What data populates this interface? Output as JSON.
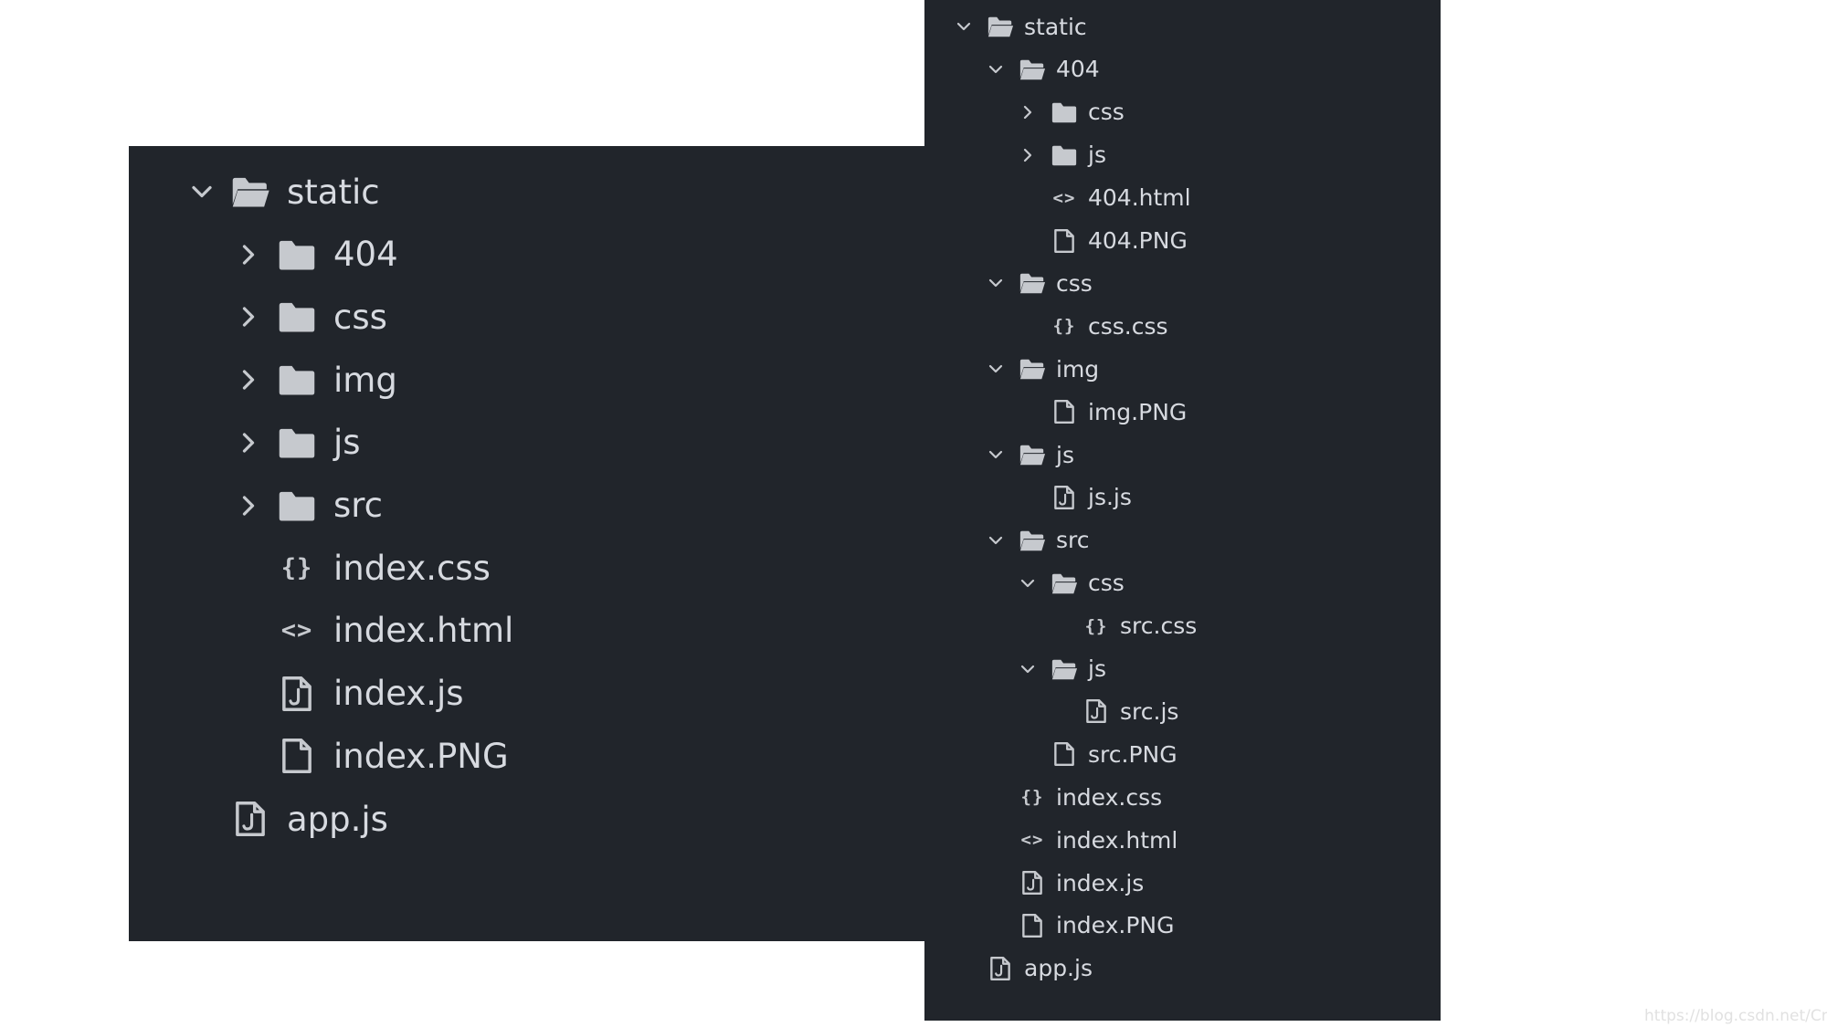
{
  "left_tree": {
    "rows": [
      {
        "depth": 0,
        "chevron": "down",
        "icon": "folder-open",
        "label": "static"
      },
      {
        "depth": 1,
        "chevron": "right",
        "icon": "folder",
        "label": "404"
      },
      {
        "depth": 1,
        "chevron": "right",
        "icon": "folder",
        "label": "css"
      },
      {
        "depth": 1,
        "chevron": "right",
        "icon": "folder",
        "label": "img"
      },
      {
        "depth": 1,
        "chevron": "right",
        "icon": "folder",
        "label": "js"
      },
      {
        "depth": 1,
        "chevron": "right",
        "icon": "folder",
        "label": "src"
      },
      {
        "depth": 1,
        "chevron": "none",
        "icon": "css-file",
        "label": "index.css"
      },
      {
        "depth": 1,
        "chevron": "none",
        "icon": "html-file",
        "label": "index.html"
      },
      {
        "depth": 1,
        "chevron": "none",
        "icon": "js-file",
        "label": "index.js"
      },
      {
        "depth": 1,
        "chevron": "none",
        "icon": "file",
        "label": "index.PNG"
      },
      {
        "depth": 0,
        "chevron": "none",
        "icon": "js-file",
        "label": "app.js"
      }
    ]
  },
  "right_tree": {
    "rows": [
      {
        "depth": 0,
        "chevron": "down",
        "icon": "folder-open",
        "label": "static"
      },
      {
        "depth": 1,
        "chevron": "down",
        "icon": "folder-open",
        "label": "404"
      },
      {
        "depth": 2,
        "chevron": "right",
        "icon": "folder",
        "label": "css"
      },
      {
        "depth": 2,
        "chevron": "right",
        "icon": "folder",
        "label": "js"
      },
      {
        "depth": 2,
        "chevron": "none",
        "icon": "html-file",
        "label": "404.html"
      },
      {
        "depth": 2,
        "chevron": "none",
        "icon": "file",
        "label": "404.PNG"
      },
      {
        "depth": 1,
        "chevron": "down",
        "icon": "folder-open",
        "label": "css"
      },
      {
        "depth": 2,
        "chevron": "none",
        "icon": "css-file",
        "label": "css.css"
      },
      {
        "depth": 1,
        "chevron": "down",
        "icon": "folder-open",
        "label": "img"
      },
      {
        "depth": 2,
        "chevron": "none",
        "icon": "file",
        "label": "img.PNG"
      },
      {
        "depth": 1,
        "chevron": "down",
        "icon": "folder-open",
        "label": "js"
      },
      {
        "depth": 2,
        "chevron": "none",
        "icon": "js-file",
        "label": "js.js"
      },
      {
        "depth": 1,
        "chevron": "down",
        "icon": "folder-open",
        "label": "src"
      },
      {
        "depth": 2,
        "chevron": "down",
        "icon": "folder-open",
        "label": "css"
      },
      {
        "depth": 3,
        "chevron": "none",
        "icon": "css-file",
        "label": "src.css"
      },
      {
        "depth": 2,
        "chevron": "down",
        "icon": "folder-open",
        "label": "js"
      },
      {
        "depth": 3,
        "chevron": "none",
        "icon": "js-file",
        "label": "src.js"
      },
      {
        "depth": 2,
        "chevron": "none",
        "icon": "file",
        "label": "src.PNG"
      },
      {
        "depth": 1,
        "chevron": "none",
        "icon": "css-file",
        "label": "index.css"
      },
      {
        "depth": 1,
        "chevron": "none",
        "icon": "html-file",
        "label": "index.html"
      },
      {
        "depth": 1,
        "chevron": "none",
        "icon": "js-file",
        "label": "index.js"
      },
      {
        "depth": 1,
        "chevron": "none",
        "icon": "file",
        "label": "index.PNG"
      },
      {
        "depth": 0,
        "chevron": "none",
        "icon": "js-file",
        "label": "app.js"
      }
    ]
  },
  "watermark": "https://blog.csdn.net/Cml_l",
  "colors": {
    "panel_bg": "#21252b",
    "text": "#d7dae0",
    "icon": "#c6c9ce",
    "page_bg": "#ffffff"
  }
}
